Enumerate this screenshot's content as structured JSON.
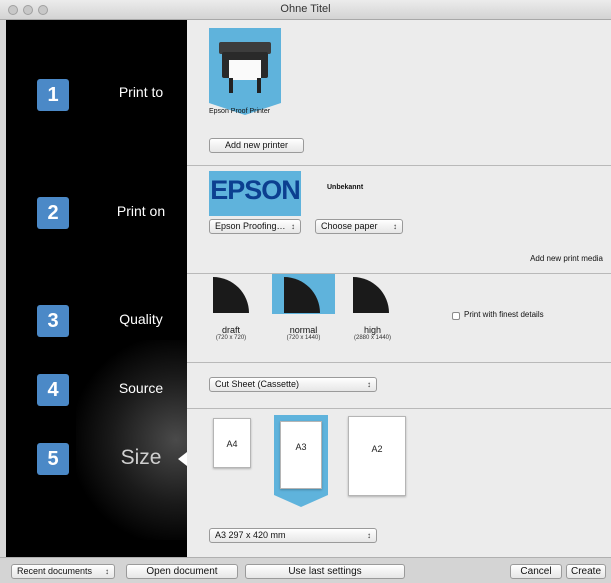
{
  "window": {
    "title": "Ohne Titel"
  },
  "sidebar": {
    "steps": [
      {
        "number": "1",
        "label": "Print to"
      },
      {
        "number": "2",
        "label": "Print on"
      },
      {
        "number": "3",
        "label": "Quality"
      },
      {
        "number": "4",
        "label": "Source"
      },
      {
        "number": "5",
        "label": "Size"
      }
    ],
    "active_step": "Size"
  },
  "print_to": {
    "printer_name": "Epson Proof Printer",
    "add_printer_label": "Add new printer"
  },
  "print_on": {
    "brand_logo": "EPSON",
    "media_status": "Unbekannt",
    "media_type_value": "Epson Proofing…",
    "paper_value": "Choose paper",
    "add_media_label": "Add new print media"
  },
  "quality": {
    "options": [
      {
        "label": "draft",
        "resolution": "(720 x 720)"
      },
      {
        "label": "normal",
        "resolution": "(720 x 1440)"
      },
      {
        "label": "high",
        "resolution": "(2880 x 1440)"
      }
    ],
    "selected": "normal",
    "finest_details_label": "Print with finest details",
    "finest_details_checked": false
  },
  "source": {
    "value": "Cut Sheet (Cassette)"
  },
  "size": {
    "papers": [
      {
        "label": "A4"
      },
      {
        "label": "A3"
      },
      {
        "label": "A2"
      }
    ],
    "selected": "A3",
    "size_value": "A3 297 x 420 mm"
  },
  "bottom_bar": {
    "recent_documents": "Recent documents",
    "open_document": "Open document",
    "use_last_settings": "Use last settings",
    "cancel": "Cancel",
    "create": "Create"
  },
  "colors": {
    "accent": "#5fb3dc",
    "step_badge": "#4b89c7",
    "sidebar_bg": "#000000"
  }
}
